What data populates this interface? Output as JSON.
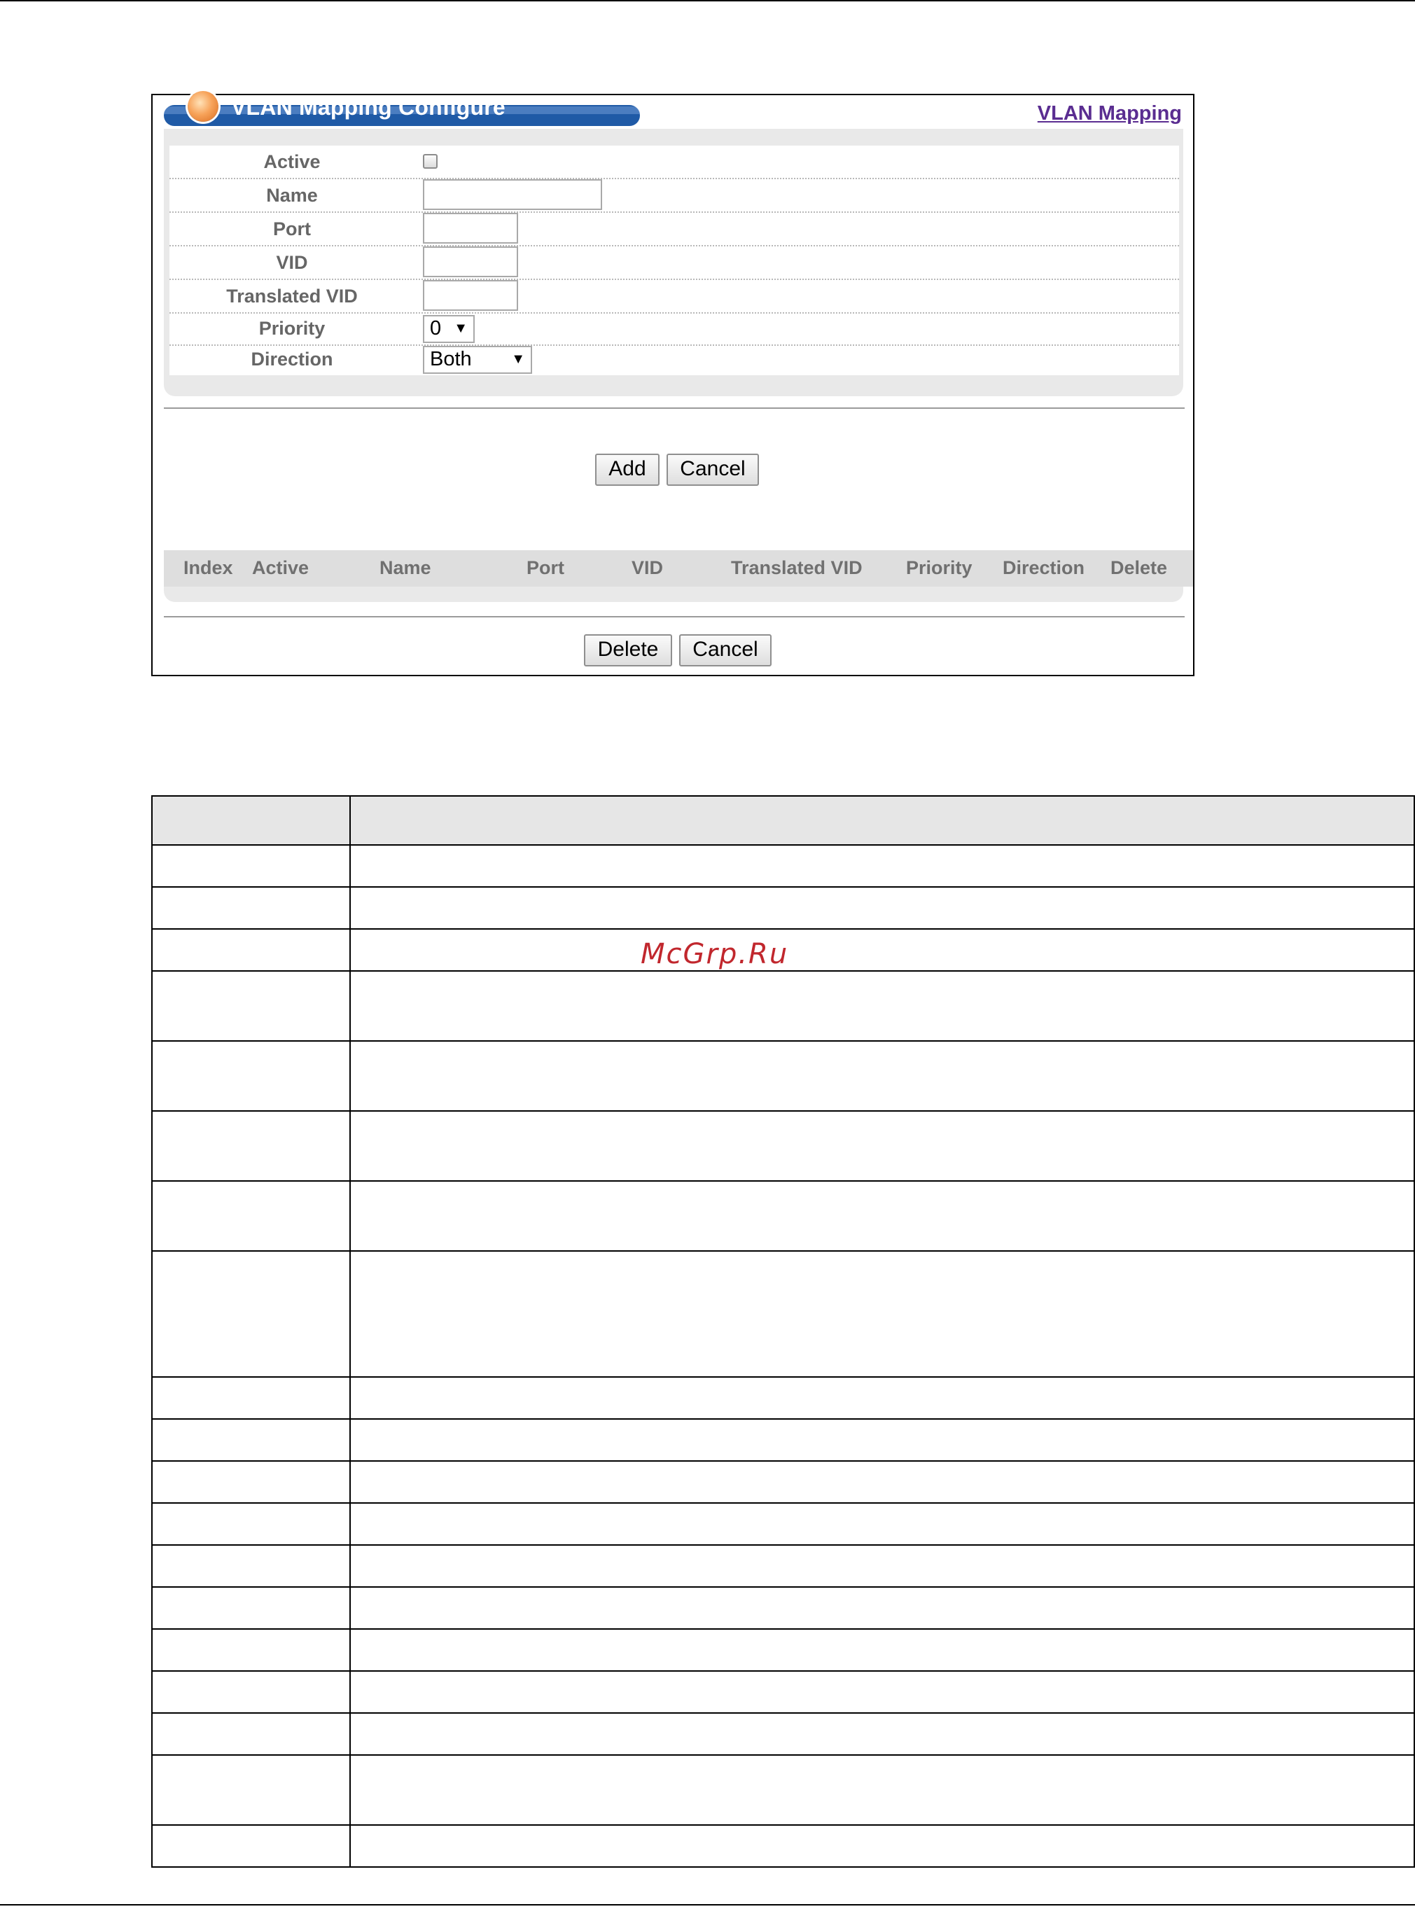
{
  "panel": {
    "title": "VLAN Mapping Configure",
    "link": "VLAN Mapping"
  },
  "form": {
    "fields": [
      {
        "label": "Active",
        "control": "checkbox"
      },
      {
        "label": "Name",
        "control": "text"
      },
      {
        "label": "Port",
        "control": "text"
      },
      {
        "label": "VID",
        "control": "text"
      },
      {
        "label": "Translated VID",
        "control": "text"
      },
      {
        "label": "Priority",
        "control": "select",
        "value": "0"
      },
      {
        "label": "Direction",
        "control": "select",
        "value": "Both"
      }
    ]
  },
  "buttons": {
    "add": "Add",
    "cancel": "Cancel",
    "delete": "Delete",
    "cancel2": "Cancel"
  },
  "list": {
    "headers": [
      "Index",
      "Active",
      "Name",
      "Port",
      "VID",
      "Translated VID",
      "Priority",
      "Direction",
      "Delete"
    ]
  },
  "watermark": "McGrp.Ru"
}
